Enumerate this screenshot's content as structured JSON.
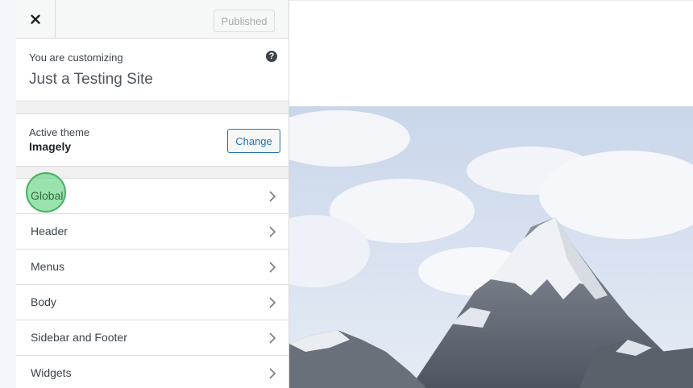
{
  "topbar": {
    "close_label": "close",
    "publish_label": "Published"
  },
  "info": {
    "customizing_label": "You are customizing",
    "site_name": "Just a Testing Site",
    "help_glyph": "?"
  },
  "theme": {
    "active_label": "Active theme",
    "name": "Imagely",
    "change_label": "Change"
  },
  "menu": {
    "items": [
      {
        "label": "Global"
      },
      {
        "label": "Header"
      },
      {
        "label": "Menus"
      },
      {
        "label": "Body"
      },
      {
        "label": "Sidebar and Footer"
      },
      {
        "label": "Widgets"
      }
    ]
  },
  "colors": {
    "accent": "#2271b1",
    "click_highlight": "#3fb35f",
    "panel_bg": "#f0f0f1"
  },
  "preview": {
    "image": "mountain-peak-photo"
  }
}
